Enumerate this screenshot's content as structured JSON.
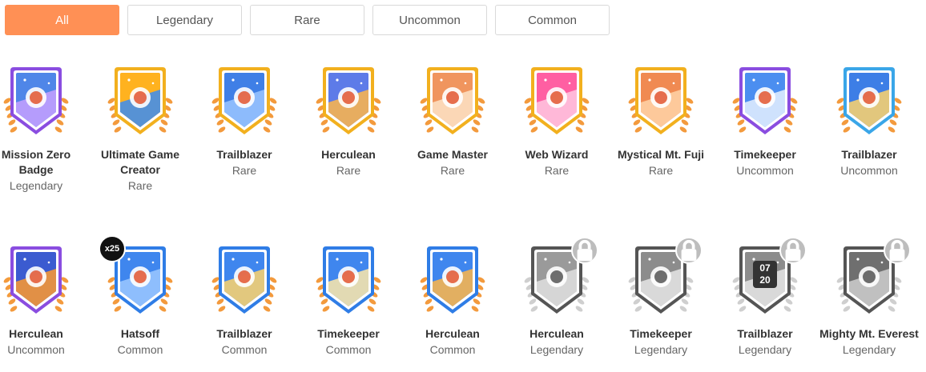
{
  "filters": [
    {
      "label": "All",
      "active": true
    },
    {
      "label": "Legendary",
      "active": false
    },
    {
      "label": "Rare",
      "active": false
    },
    {
      "label": "Uncommon",
      "active": false
    },
    {
      "label": "Common",
      "active": false
    }
  ],
  "badges_row1": [
    {
      "name": "Mission Zero Badge",
      "rarity": "Legendary",
      "icon": "target-arrow-icon",
      "frame": "#8a4de0",
      "bg1": "#4f86e8",
      "bg2": "#c7a0ff"
    },
    {
      "name": "Ultimate Game Creator",
      "rarity": "Rare",
      "icon": "game-controller-icon",
      "frame": "#f2b01e",
      "bg1": "#ffb21f",
      "bg2": "#3a8cf5"
    },
    {
      "name": "Trailblazer",
      "rarity": "Rare",
      "icon": "stopwatch-icon",
      "frame": "#f2b01e",
      "bg1": "#3f7fe6",
      "bg2": "#9bc6ff"
    },
    {
      "name": "Herculean",
      "rarity": "Rare",
      "icon": "flexed-arm-icon",
      "frame": "#f2b01e",
      "bg1": "#5d7be8",
      "bg2": "#ffb648"
    },
    {
      "name": "Game Master",
      "rarity": "Rare",
      "icon": "joystick-icon",
      "frame": "#f2b01e",
      "bg1": "#f0955e",
      "bg2": "#fde3c5"
    },
    {
      "name": "Web Wizard",
      "rarity": "Rare",
      "icon": "browser-window-icon",
      "frame": "#f2b01e",
      "bg1": "#ff5fa2",
      "bg2": "#ffc8e2"
    },
    {
      "name": "Mystical Mt. Fuji",
      "rarity": "Rare",
      "icon": "mountain-flag-icon",
      "frame": "#f2b01e",
      "bg1": "#f08a52",
      "bg2": "#ffd4a8"
    },
    {
      "name": "Timekeeper",
      "rarity": "Uncommon",
      "icon": "paper-plane-icon",
      "frame": "#8a4de0",
      "bg1": "#4b8ef0",
      "bg2": "#e6f1ff"
    },
    {
      "name": "Trailblazer",
      "rarity": "Uncommon",
      "icon": "hourglass-icon",
      "frame": "#3aa6e8",
      "bg1": "#3d7ee6",
      "bg2": "#ffd36a"
    }
  ],
  "badges_row2": [
    {
      "name": "Herculean",
      "rarity": "Uncommon",
      "icon": "barbell-icon",
      "frame": "#8a4de0",
      "bg1": "#3b5bd0",
      "bg2": "#ff9a2e"
    },
    {
      "name": "Hatsoff",
      "rarity": "Common",
      "icon": "graduation-cap-icon",
      "frame": "#2f7de6",
      "bg1": "#3f86ee",
      "bg2": "#9cc8ff",
      "count": "x25"
    },
    {
      "name": "Trailblazer",
      "rarity": "Common",
      "icon": "sundial-icon",
      "frame": "#2f7de6",
      "bg1": "#3f86ee",
      "bg2": "#ffd36a"
    },
    {
      "name": "Timekeeper",
      "rarity": "Common",
      "icon": "paper-plane-icon",
      "frame": "#2f7de6",
      "bg1": "#3f86ee",
      "bg2": "#ffe9a8"
    },
    {
      "name": "Herculean",
      "rarity": "Common",
      "icon": "dumbbell-arm-icon",
      "frame": "#2f7de6",
      "bg1": "#3f86ee",
      "bg2": "#ffb648"
    },
    {
      "name": "Herculean",
      "rarity": "Legendary",
      "icon": "atlas-globe-icon",
      "frame": "#555555",
      "bg1": "#9a9a9a",
      "bg2": "#e0e0e0",
      "locked": true
    },
    {
      "name": "Timekeeper",
      "rarity": "Legendary",
      "icon": "rocket-icon",
      "frame": "#555555",
      "bg1": "#8c8c8c",
      "bg2": "#e6e6e6",
      "locked": true
    },
    {
      "name": "Trailblazer",
      "rarity": "Legendary",
      "icon": "smartwatch-icon",
      "frame": "#555555",
      "bg1": "#8c8c8c",
      "bg2": "#e6e6e6",
      "locked": true,
      "watch_text_1": "07",
      "watch_text_2": "20"
    },
    {
      "name": "Mighty Mt. Everest",
      "rarity": "Legendary",
      "icon": "mountain-peak-icon",
      "frame": "#555555",
      "bg1": "#6f6f6f",
      "bg2": "#cfcfcf",
      "locked": true
    }
  ]
}
